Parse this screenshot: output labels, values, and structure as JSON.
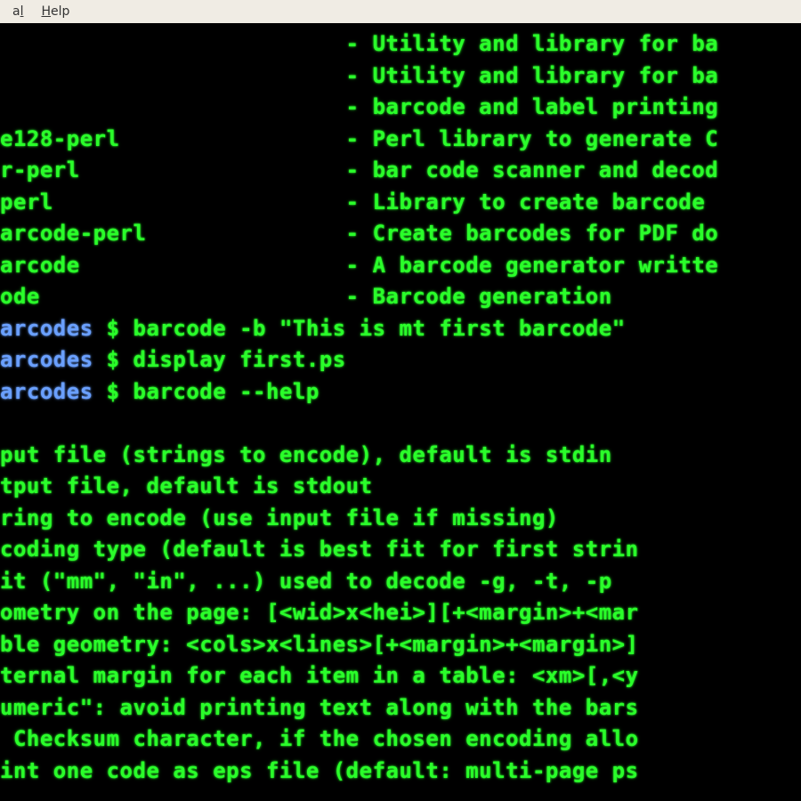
{
  "menubar": {
    "items": [
      {
        "prefix": "a",
        "accel": "l",
        "suffix": ""
      },
      {
        "prefix": "",
        "accel": "H",
        "suffix": "elp"
      }
    ]
  },
  "packages": [
    {
      "name": "",
      "desc": "Utility and library for ba"
    },
    {
      "name": "",
      "desc": "Utility and library for ba"
    },
    {
      "name": "",
      "desc": "barcode and label printing"
    },
    {
      "name": "e128-perl",
      "desc": "Perl library to generate C"
    },
    {
      "name": "r-perl",
      "desc": "bar code scanner and decod"
    },
    {
      "name": "perl",
      "desc": "Library to create barcode "
    },
    {
      "name": "arcode-perl",
      "desc": "Create barcodes for PDF do"
    },
    {
      "name": "arcode",
      "desc": "A barcode generator writte"
    },
    {
      "name": "ode",
      "desc": "Barcode generation"
    }
  ],
  "prompts": [
    {
      "cwd": "arcodes",
      "cmd": "barcode -b \"This is mt first barcode\""
    },
    {
      "cwd": "arcodes",
      "cmd": "display first.ps"
    },
    {
      "cwd": "arcodes",
      "cmd": "barcode --help"
    }
  ],
  "help": [
    "put file (strings to encode), default is stdin",
    "tput file, default is stdout",
    "ring to encode (use input file if missing)",
    "coding type (default is best fit for first strin",
    "it (\"mm\", \"in\", ...) used to decode -g, -t, -p",
    "ometry on the page: [<wid>x<hei>][+<margin>+<mar",
    "ble geometry: <cols>x<lines>[+<margin>+<margin>]",
    "ternal margin for each item in a table: <xm>[,<y",
    "umeric\": avoid printing text along with the bars",
    " Checksum character, if the chosen encoding allo",
    "int one code as eps file (default: multi-page ps"
  ],
  "layout": {
    "dash_col": 26
  }
}
